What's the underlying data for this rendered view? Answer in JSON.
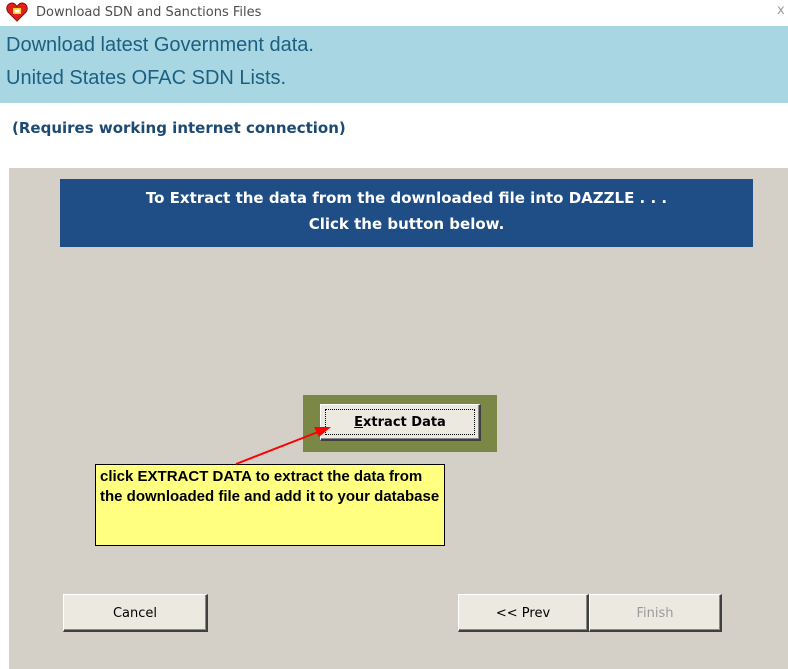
{
  "window": {
    "title": "Download SDN and Sanctions  Files",
    "close_glyph": "x",
    "icon": "heart-app-icon"
  },
  "header": {
    "line1": "Download latest Government data.",
    "line2": "United States OFAC SDN Lists."
  },
  "requires_note": "(Requires working internet connection)",
  "banner": {
    "line1": "To Extract the data from the downloaded file into DAZZLE . . .",
    "line2": "Click the button below."
  },
  "extract_button": {
    "accelerator": "E",
    "label_rest": "xtract Data"
  },
  "callout": {
    "text": "click EXTRACT DATA to extract the data from the downloaded file and add it to your database"
  },
  "footer": {
    "cancel": "Cancel",
    "prev": "<< Prev",
    "finish": "Finish"
  },
  "colors": {
    "header_bg": "#a8d7e3",
    "header_text": "#1c5f80",
    "banner_bg": "#1f4e86",
    "panel_bg": "#d4d0c8",
    "frame": "#7b8744",
    "callout_bg": "#ffff80",
    "arrow": "#ff0000"
  }
}
